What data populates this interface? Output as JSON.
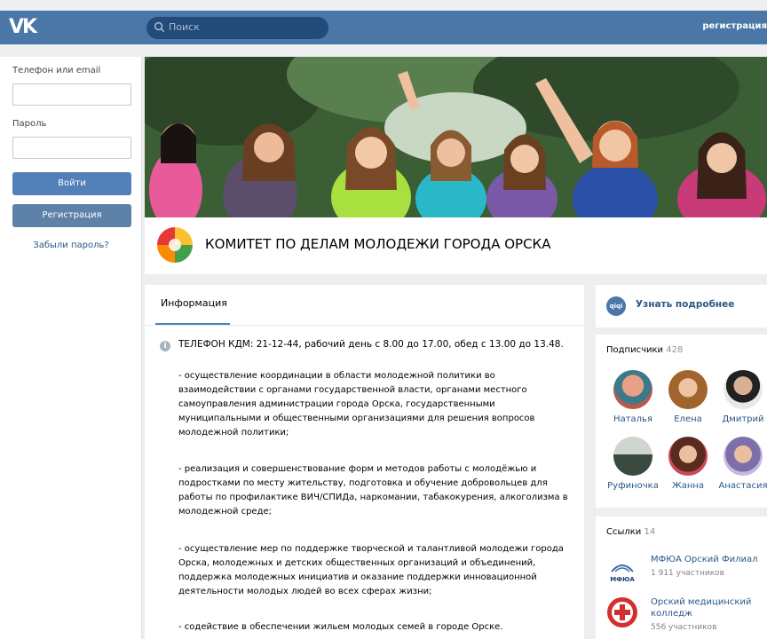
{
  "topbar": {
    "logo": "VK",
    "search_placeholder": "Поиск",
    "register_link": "регистрация"
  },
  "login": {
    "phone_label": "Телефон или email",
    "password_label": "Пароль",
    "login_button": "Войти",
    "register_button": "Регистрация",
    "forgot_link": "Забыли пароль?"
  },
  "group": {
    "title": "КОМИТЕТ ПО ДЕЛАМ МОЛОДЕЖИ ГОРОДА ОРСКА"
  },
  "info": {
    "tab_label": "Информация",
    "phone_line": "ТЕЛЕФОН КДМ: 21-12-44, рабочий день с 8.00 до 17.00, обед с 13.00 до 13.48.",
    "paragraphs": [
      "- осуществление координации в области молодежной политики во взаимодействии с органами государственной власти, органами местного самоуправления администрации города Орска, государственными муниципальными и общественными организациями для решения вопросов молодежной политики;",
      "- реализация и совершенствование форм и методов работы с молодёжью и подростками по месту жительству, подготовка и обучение добровольцев для работы по профилактике ВИЧ/СПИДа, наркомании, табакокурения, алкоголизма в молодежной среде;",
      "- осуществление мер по поддержке творческой и талантливой молодежи города Орска, молодежных и детских общественных организаций и объединений, поддержка молодежных инициатив и оказание поддержки инновационной деятельности молодых людей во всех сферах жизни;",
      "- содействие в обеспечении жильем молодых семей в городе Орске."
    ]
  },
  "more": {
    "icon_text": "qiqi",
    "label": "Узнать подробнее"
  },
  "subscribers": {
    "title": "Подписчики",
    "count": "428",
    "people": [
      {
        "name": "Наталья",
        "color": "#8a4a3a"
      },
      {
        "name": "Елена",
        "color": "#a8743c"
      },
      {
        "name": "Дмитрий",
        "color": "#5a5a5a"
      },
      {
        "name": "Руфиночка",
        "color": "#4f6e55"
      },
      {
        "name": "Жанна",
        "color": "#6b3a2e"
      },
      {
        "name": "Анастасия",
        "color": "#7d6fa8"
      }
    ]
  },
  "links": {
    "title": "Ссылки",
    "count": "14",
    "items": [
      {
        "name": "МФЮА Орский Филиал",
        "meta": "1 911 участников",
        "logo_text": "МФЮА"
      },
      {
        "name": "Орский медицинский колледж",
        "meta": "556 участников",
        "logo_text": "+"
      }
    ]
  },
  "colors": {
    "accent": "#4a76a8",
    "link": "#2a5885",
    "button": "#5181b8"
  }
}
